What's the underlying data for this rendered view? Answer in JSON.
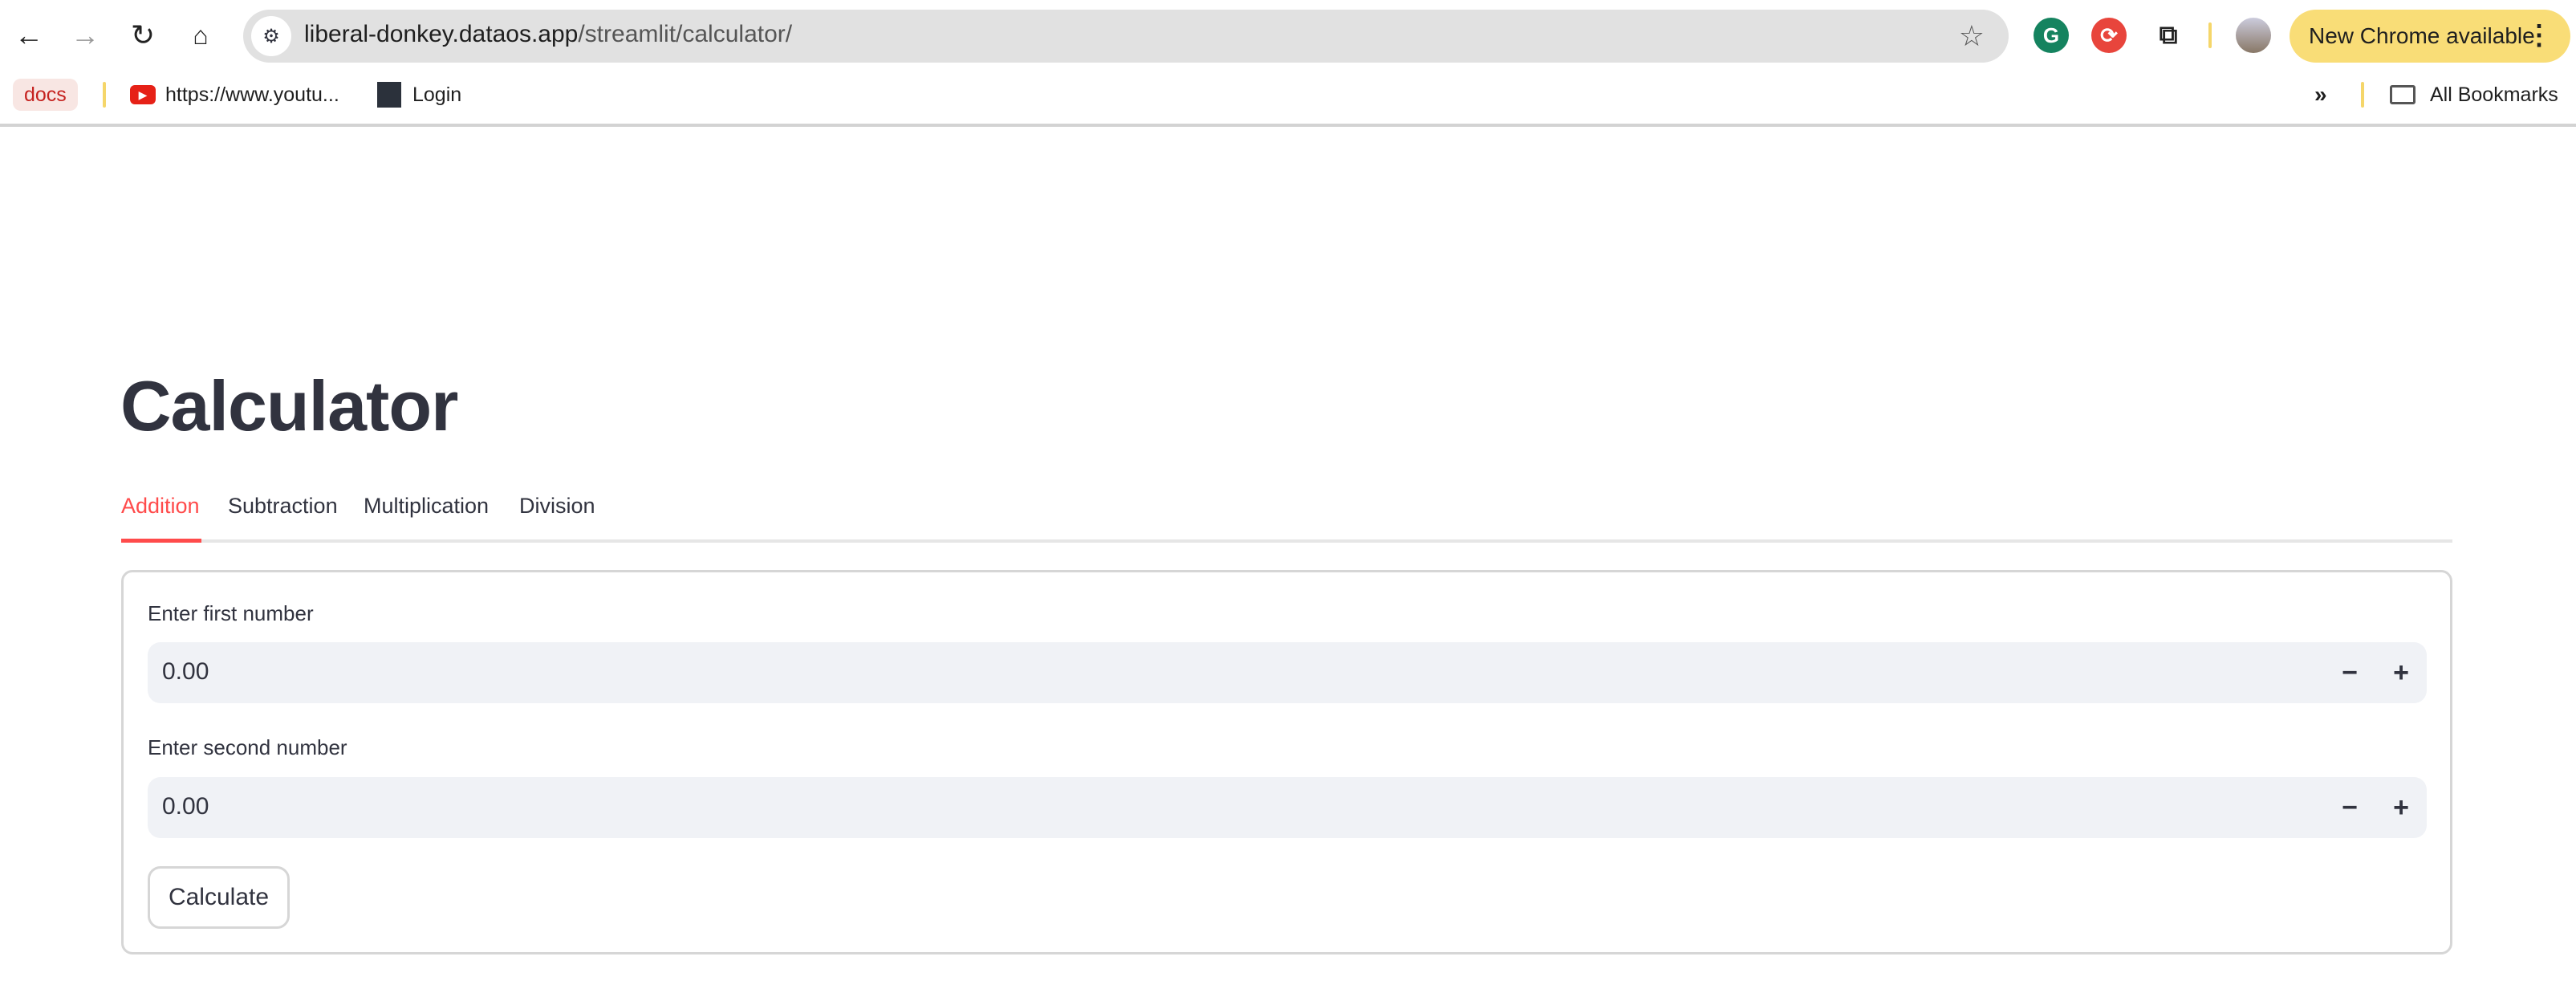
{
  "browser": {
    "url_host": "liberal-donkey.dataos.app",
    "url_path": "/streamlit/calculator/",
    "update_label": "New Chrome available",
    "bookmarks": [
      {
        "label": "docs",
        "icon": "docs-chip"
      },
      {
        "label": "https://www.youtu...",
        "icon": "youtube-icon"
      },
      {
        "label": "Login",
        "icon": "login-site-icon"
      }
    ],
    "all_bookmarks_label": "All Bookmarks"
  },
  "app": {
    "title": "Calculator",
    "tabs": [
      {
        "label": "Addition",
        "active": true
      },
      {
        "label": "Subtraction",
        "active": false
      },
      {
        "label": "Multiplication",
        "active": false
      },
      {
        "label": "Division",
        "active": false
      }
    ],
    "accent_color": "#ff4b4b",
    "form": {
      "first_label": "Enter first number",
      "first_value": "0.00",
      "second_label": "Enter second number",
      "second_value": "0.00",
      "minus": "−",
      "plus": "+",
      "calculate_label": "Calculate"
    }
  }
}
